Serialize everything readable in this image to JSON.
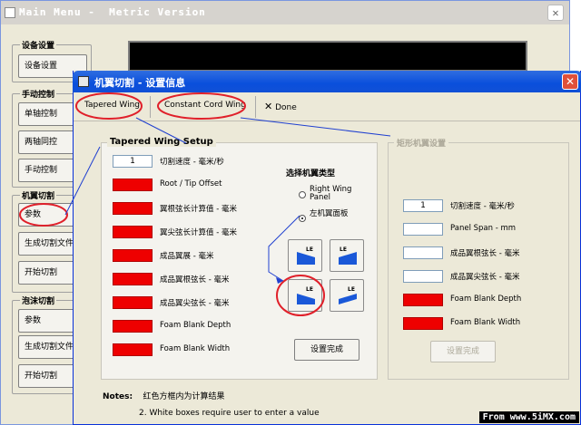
{
  "main_window": {
    "title": "Main Menu -  Metric Version",
    "close_label": "✕",
    "groups": [
      {
        "title": "设备设置",
        "buttons": [
          "设备设置"
        ]
      },
      {
        "title": "手动控制",
        "buttons": [
          "单轴控制",
          "两轴同控",
          "手动控制"
        ]
      },
      {
        "title": "机翼切割",
        "buttons": [
          "参数",
          "生成切割文件",
          "开始切割"
        ]
      },
      {
        "title": "泡沫切割",
        "buttons": [
          "参数",
          "生成切割文件",
          "开始切割"
        ]
      }
    ]
  },
  "dialog": {
    "title": "机翼切割 - 设置信息",
    "close_label": "✕",
    "toolbar": {
      "tab1": "Tapered Wing",
      "tab2": "Constant Cord Wing",
      "done": "Done"
    },
    "left_panel": {
      "title": "Tapered Wing Setup",
      "speed_value": "1",
      "labels": [
        "切割速度 - 毫米/秒",
        "Root / Tip Offset",
        "翼根弦长计算值 - 毫米",
        "翼尖弦长计算值 - 毫米",
        "成品翼展 - 毫米",
        "成品翼根弦长 - 毫米",
        "成品翼尖弦长 - 毫米",
        "Foam Blank Depth",
        "Foam Blank Width"
      ],
      "wing_type_title": "选择机翼类型",
      "radio_right": "Right Wing Panel",
      "radio_left": "左机翼面板",
      "radio_selected": "left",
      "le_label": "LE",
      "done_button": "设置完成"
    },
    "right_panel": {
      "title": "矩形机翼设置",
      "speed_value": "1",
      "labels": [
        "切割速度 - 毫米/秒",
        "Panel Span - mm",
        "成品翼根弦长 - 毫米",
        "成品翼尖弦长 - 毫米",
        "Foam Blank Depth",
        "Foam Blank Width"
      ],
      "done_button": "设置完成"
    },
    "notes": {
      "label": "Notes:",
      "line1": "红色方框内为计算结果",
      "line2": "2. White boxes require user to enter a value"
    }
  },
  "watermark": "From www.5iMX.com",
  "colors": {
    "accent_red": "#ee0000",
    "titlebar_blue": "#0a4fdc",
    "annotation_red": "#e0202a",
    "annotation_blue": "#2040d0"
  }
}
